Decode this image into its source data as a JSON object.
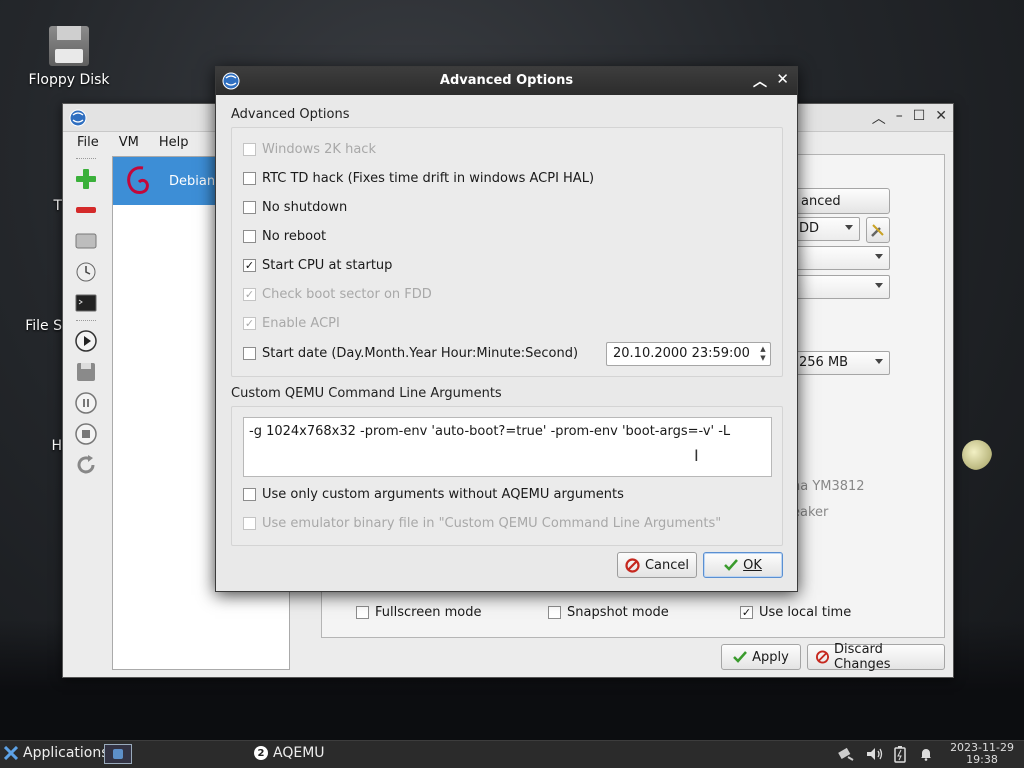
{
  "desktop": {
    "icons": [
      {
        "label": "Floppy Disk"
      },
      {
        "label": "T"
      },
      {
        "label": "File S"
      },
      {
        "label": "H"
      }
    ]
  },
  "main_window": {
    "menu": [
      "File",
      "VM",
      "Help"
    ],
    "vm_list": [
      {
        "name": "Debian"
      }
    ],
    "settings": {
      "advanced_button": "anced",
      "boot_combo": "DD",
      "memory_combo": "256 MB",
      "sound_label": "na YM3812",
      "speaker_label": "eaker",
      "fullscreen_label": "Fullscreen mode",
      "snapshot_label": "Snapshot mode",
      "local_time_label": "Use local time",
      "local_time_checked": "✓"
    },
    "apply_button": "Apply",
    "discard_button": "Discard Changes"
  },
  "dialog": {
    "title": "Advanced Options",
    "group1_title": "Advanced Options",
    "options": [
      {
        "label": "Windows 2K hack",
        "checked": "",
        "disabled": true
      },
      {
        "label": "RTC TD hack (Fixes time drift in windows ACPI HAL)",
        "checked": "",
        "disabled": false
      },
      {
        "label": "No shutdown",
        "checked": "",
        "disabled": false
      },
      {
        "label": "No reboot",
        "checked": "",
        "disabled": false
      },
      {
        "label": "Start CPU at startup",
        "checked": "✓",
        "disabled": false
      },
      {
        "label": "Check boot sector on FDD",
        "checked": "✓",
        "disabled": true
      },
      {
        "label": "Enable ACPI",
        "checked": "✓",
        "disabled": true
      },
      {
        "label": "Start date (Day.Month.Year Hour:Minute:Second)",
        "checked": "",
        "disabled": false
      }
    ],
    "start_date_value": "20.10.2000 23:59:00",
    "group2_title": "Custom QEMU Command Line Arguments",
    "custom_args": "-g 1024x768x32 -prom-env 'auto-boot?=true' -prom-env 'boot-args=-v' -L",
    "only_custom_label": "Use only custom arguments without AQEMU arguments",
    "only_custom_checked": "",
    "use_binary_label": "Use emulator binary file in \"Custom QEMU Command Line Arguments\"",
    "use_binary_checked": "",
    "cancel_label": "Cancel",
    "ok_label": "OK"
  },
  "taskbar": {
    "applications_label": "Applications",
    "task_label": "AQEMU",
    "task_badge": "2",
    "date": "2023-11-29",
    "time": "19:38"
  },
  "colors": {
    "selection": "#3d8ed6",
    "dialog_title_bg": "#2f2f2f",
    "ok_check": "#3a9b2d",
    "cancel_icon": "#c6281f"
  }
}
